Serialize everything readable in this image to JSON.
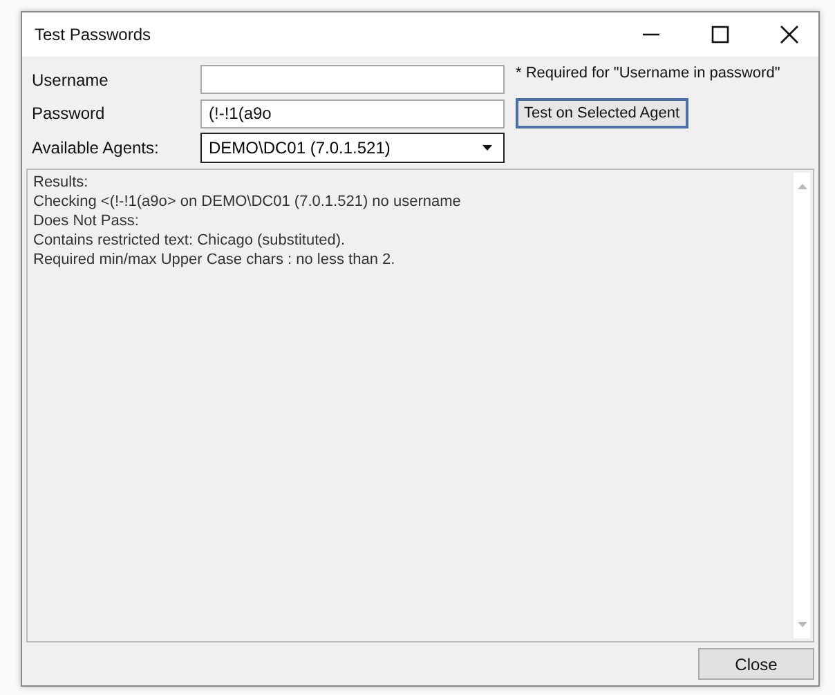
{
  "window": {
    "title": "Test Passwords"
  },
  "fields": [
    {
      "label": "Username",
      "kind": "text"
    },
    {
      "label": "Password",
      "kind": "text",
      "value": "(!-!1(a9o"
    },
    {
      "label": "Available Agents:",
      "kind": "dropdown",
      "value": "DEMO\\DC01 (7.0.1.521)"
    }
  ],
  "note": "* Required for \"Username in password\"",
  "test_button": "Test on Selected Agent",
  "results": [
    "Results:",
    "Checking <(!-!1(a9o> on DEMO\\DC01 (7.0.1.521) no username",
    "Does Not Pass:",
    "Contains restricted text: Chicago (substituted).",
    "Required min/max Upper Case chars : no less than 2."
  ],
  "buttons": [
    "Close"
  ]
}
